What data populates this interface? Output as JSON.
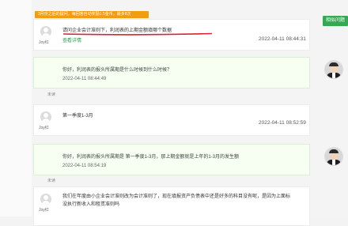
{
  "notice": {
    "text": "3月份之后的提问，每回答自动奖励1.5金币，最多8次"
  },
  "similar_button": {
    "label": "相似问题"
  },
  "thread": {
    "q1": {
      "user": "Joy红",
      "text": "请问企业会计准则下，利润表的上期金额填哪个数据",
      "time": "2022-04-11 08:44:31",
      "detail_link": "查看详情"
    },
    "a1": {
      "text": "你好，利润表的报头所属期是什么时候到什么时候？",
      "time": "2022-04-11 08:44:49",
      "unread": "未读"
    },
    "q2": {
      "user": "Joy红",
      "text": "第一季度1-3月",
      "time": "2022-04-11 08:52:59"
    },
    "a2": {
      "text": "你好，利润表的报头所属期是 第一季度1-3月，那上期金额就是上年的1-3月的发生额",
      "time": "2022-04-11 08:54:19",
      "unread": "未读"
    },
    "q3": {
      "user": "Joy红",
      "text_line1": "我们在年度由小企业会计准则改为会计准则了，现在填报资产负债表中还是好多的科目没有呢，是因为上面标",
      "text_line2": "没执行新收入和租赁准则吗"
    }
  },
  "colors": {
    "accent": "#34a853",
    "notice": "#f39c12",
    "underline": "#d9252b"
  }
}
